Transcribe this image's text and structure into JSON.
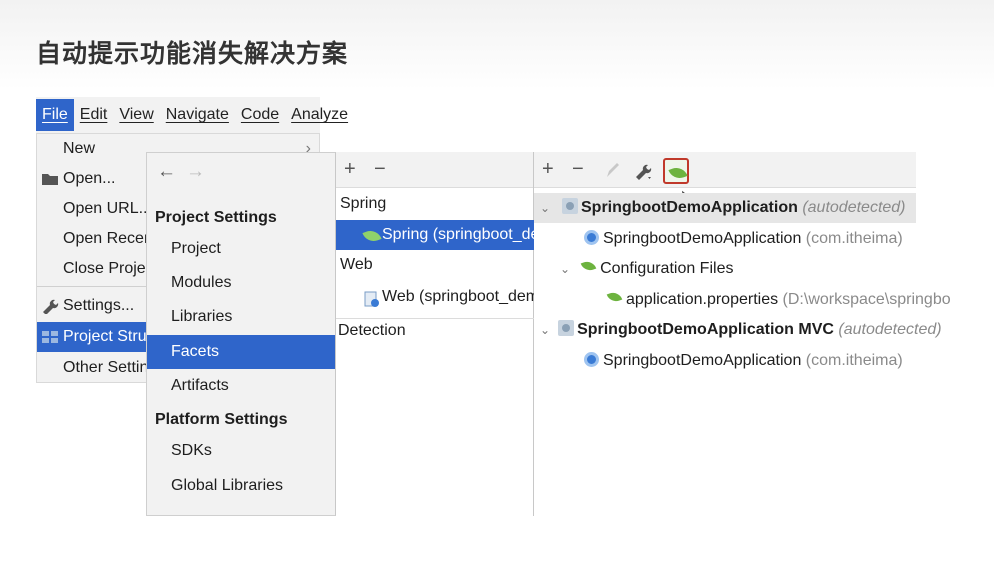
{
  "slide": {
    "title": "自动提示功能消失解决方案"
  },
  "menubar": {
    "items": [
      "File",
      "Edit",
      "View",
      "Navigate",
      "Code",
      "Analyze"
    ],
    "active": "File"
  },
  "file_menu": {
    "items": [
      {
        "label": "New",
        "icon": "none",
        "submenu": true
      },
      {
        "label": "Open...",
        "icon": "folder-icon"
      },
      {
        "label": "Open URL..."
      },
      {
        "label": "Open Recent"
      },
      {
        "label": "Close Project"
      },
      {
        "label": "Settings...",
        "icon": "wrench-icon"
      },
      {
        "label": "Project Struct",
        "icon": "project-structure-icon",
        "selected": true
      },
      {
        "label": "Other Setting"
      }
    ]
  },
  "project_structure": {
    "back_arrow": "←",
    "forward_arrow": "→",
    "project_settings_heading": "Project Settings",
    "project_settings_items": [
      "Project",
      "Modules",
      "Libraries",
      "Facets",
      "Artifacts"
    ],
    "selected_item": "Facets",
    "platform_settings_heading": "Platform Settings",
    "platform_settings_items": [
      "SDKs",
      "Global Libraries"
    ]
  },
  "facets": {
    "toolbar": {
      "add": "+",
      "remove": "−"
    },
    "groups": [
      {
        "label": "Spring",
        "children": [
          "Spring (springboot_dem"
        ]
      },
      {
        "label": "Web",
        "children": [
          "Web (springboot_demo)"
        ]
      }
    ],
    "selected": "Spring (springboot_dem",
    "detection_label": "Detection"
  },
  "spring_detail": {
    "toolbar": {
      "add": "+",
      "remove": "−",
      "edit_icon": "pencil-icon",
      "wrench_icon": "wrench-icon",
      "spring_icon": "spring-leaf-icon",
      "highlight_color": "#c0392b"
    },
    "contexts": [
      {
        "name": "SpringbootDemoApplication",
        "suffix": "(autodetected)",
        "children": [
          {
            "name": "SpringbootDemoApplication",
            "pkg": "(com.itheima)"
          },
          {
            "name": "Configuration Files",
            "children": [
              {
                "name": "application.properties",
                "path": "(D:\\workspace\\springbo"
              }
            ]
          }
        ]
      },
      {
        "name": "SpringbootDemoApplication MVC",
        "suffix": "(autodetected)",
        "children": [
          {
            "name": "SpringbootDemoApplication",
            "pkg": "(com.itheima)"
          }
        ]
      }
    ]
  },
  "colors": {
    "selection": "#2f65ca",
    "panel": "#f2f2f2",
    "spring_green": "#6db33f"
  }
}
